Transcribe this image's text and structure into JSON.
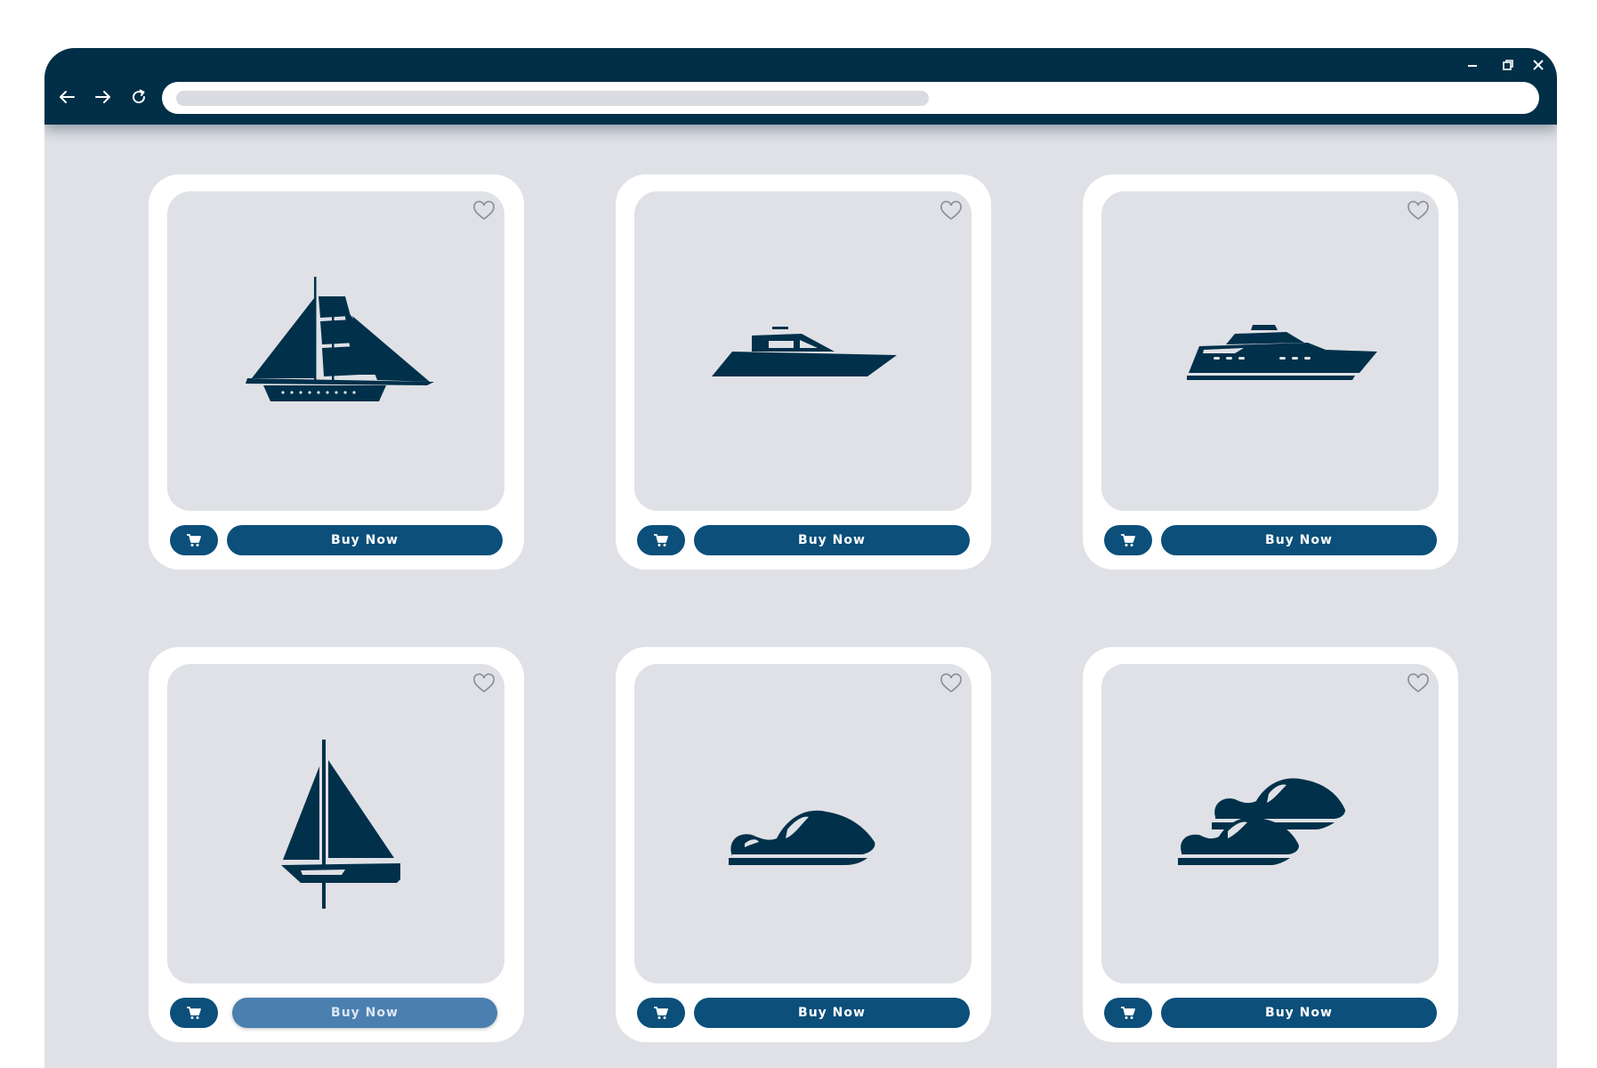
{
  "browser": {
    "address_placeholder": "",
    "controls": [
      "minimize-icon",
      "restore-icon",
      "close-icon"
    ],
    "nav": [
      "back-arrow-icon",
      "forward-arrow-icon",
      "reload-icon"
    ]
  },
  "colors": {
    "titlebar": "#002f47",
    "page_background": "#dfe1e6",
    "button": "#0b4f7a",
    "button_hover": "#4a7fb0",
    "boat_silhouette": "#00304a"
  },
  "products": [
    {
      "icon": "schooner-icon",
      "buy_label": "Buy Now",
      "favorite": false
    },
    {
      "icon": "speedboat-icon",
      "buy_label": "Buy Now",
      "favorite": false
    },
    {
      "icon": "yacht-icon",
      "buy_label": "Buy Now",
      "favorite": false
    },
    {
      "icon": "sailboat-icon",
      "buy_label": "Buy Now",
      "favorite": false,
      "buy_hovered": true
    },
    {
      "icon": "jet-ski-icon",
      "buy_label": "Buy Now",
      "favorite": false
    },
    {
      "icon": "two-jet-skis-icon",
      "buy_label": "Buy Now",
      "favorite": false
    }
  ]
}
